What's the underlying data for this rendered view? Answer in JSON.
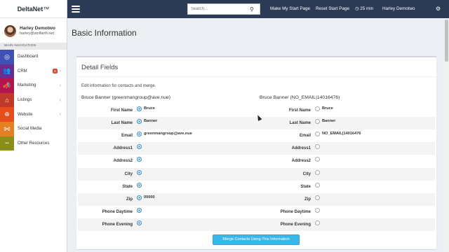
{
  "brand": {
    "name": "DeltaNet",
    "mark": "™"
  },
  "user": {
    "name": "Harley Demotwo",
    "email": "harley@wolfarth.net"
  },
  "sidebar": {
    "header": "MAIN NAVIGATION",
    "items": [
      {
        "label": "Dashboard",
        "color": "#3f51b5",
        "icon": "dashboard-icon",
        "glyph": "◎"
      },
      {
        "label": "CRM",
        "color": "#6a2c91",
        "icon": "users-icon",
        "glyph": "👥",
        "badge": "4",
        "chevron": "‹"
      },
      {
        "label": "Marketing",
        "color": "#b3144e",
        "icon": "megaphone-icon",
        "glyph": "📣",
        "chevron": "‹"
      },
      {
        "label": "Listings",
        "color": "#c0392b",
        "icon": "home-icon",
        "glyph": "⌂",
        "chevron": "‹"
      },
      {
        "label": "Website",
        "color": "#e74c1c",
        "icon": "globe-icon",
        "glyph": "⊕",
        "chevron": "‹"
      },
      {
        "label": "Social Media",
        "color": "#e67e22",
        "icon": "share-icon",
        "glyph": "⋈"
      },
      {
        "label": "Other Resources",
        "color": "#8a8f1a",
        "icon": "ellipsis-icon",
        "glyph": "•••"
      }
    ]
  },
  "topbar": {
    "search_placeholder": "Search...",
    "make_start": "Make My Start Page",
    "reset_start": "Reset Start Page",
    "timer": "25 min",
    "user": "Harley Demotwo"
  },
  "page": {
    "title": "Basic Information"
  },
  "panel": {
    "title": "Detail Fields",
    "description": "Edit information for contacts and merge.",
    "contact_a": "Bruce Banner (greenmangroup@ave.nue)",
    "contact_b": "Bruce Banner (NO_EMAIL|14016476)",
    "fields": [
      {
        "label": "First Name",
        "a": "Bruce",
        "b": "Bruce",
        "a_selected": true,
        "b_selected": false
      },
      {
        "label": "Last Name",
        "a": "Banner",
        "b": "Banner",
        "a_selected": true,
        "b_selected": false
      },
      {
        "label": "Email",
        "a": "greenmangroup@ave.nue",
        "b": "NO_EMAIL|14016476",
        "a_selected": true,
        "b_selected": false
      },
      {
        "label": "Address1",
        "a": "",
        "b": "",
        "a_selected": true,
        "b_selected": false
      },
      {
        "label": "Address2",
        "a": "",
        "b": "",
        "a_selected": true,
        "b_selected": false
      },
      {
        "label": "City",
        "a": "",
        "b": "",
        "a_selected": true,
        "b_selected": false
      },
      {
        "label": "State",
        "a": "",
        "b": "",
        "a_selected": true,
        "b_selected": false
      },
      {
        "label": "Zip",
        "a": "00000",
        "b": "",
        "a_selected": true,
        "b_selected": false
      },
      {
        "label": "Phone Daytime",
        "a": "",
        "b": "",
        "a_selected": true,
        "b_selected": false
      },
      {
        "label": "Phone Evening",
        "a": "",
        "b": "",
        "a_selected": true,
        "b_selected": false
      }
    ],
    "merge_button": "Merge Contacts Using This Information"
  }
}
